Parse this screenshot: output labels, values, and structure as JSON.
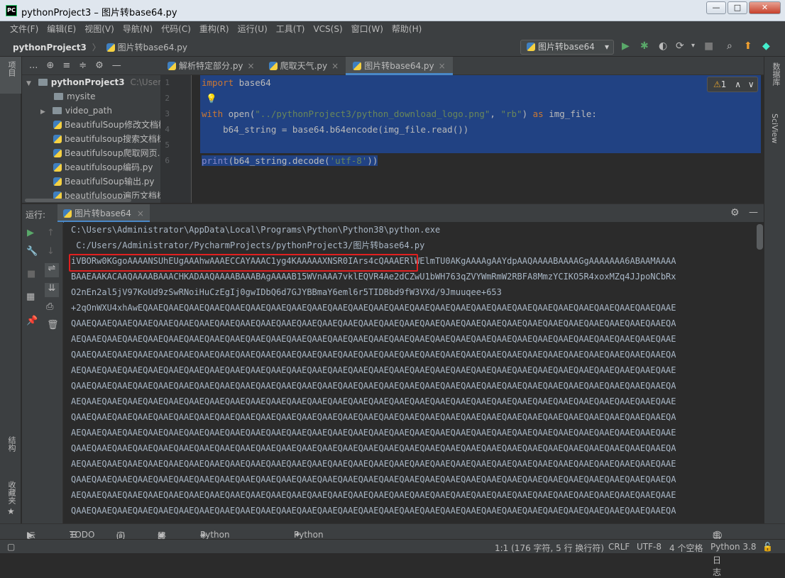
{
  "window": {
    "title": "pythonProject3 – 图片转base64.py",
    "logo_text": "PC",
    "minimize": "—",
    "maximize": "□",
    "close": "✕"
  },
  "menu": [
    "文件(F)",
    "编辑(E)",
    "视图(V)",
    "导航(N)",
    "代码(C)",
    "重构(R)",
    "运行(U)",
    "工具(T)",
    "VCS(S)",
    "窗口(W)",
    "帮助(H)"
  ],
  "breadcrumb": {
    "project": "pythonProject3",
    "file": "图片转base64.py"
  },
  "run_config": "图片转base64",
  "left_strip_label": "项目",
  "left_strip_bottom": [
    "结构",
    "收藏夹"
  ],
  "right_strip_labels": [
    "数据库",
    "SciView"
  ],
  "project_tools": {
    "dropdown": "...",
    "target": "⊕",
    "collapse": "≡",
    "expand": "≑",
    "settings": "⚙",
    "hide": "—"
  },
  "project_tree": {
    "root": {
      "name": "pythonProject3",
      "path": "C:\\Users"
    },
    "items": [
      {
        "type": "folder",
        "name": "mysite",
        "expandable": false
      },
      {
        "type": "folder",
        "name": "video_path",
        "expandable": true
      },
      {
        "type": "file",
        "name": "BeautifulSoup修改文档树"
      },
      {
        "type": "file",
        "name": "beautifulsoup搜索文档树"
      },
      {
        "type": "file",
        "name": "Beautifulsoup爬取网页.py"
      },
      {
        "type": "file",
        "name": "beautifulsoup编码.py"
      },
      {
        "type": "file",
        "name": "BeautifulSoup输出.py"
      },
      {
        "type": "file",
        "name": "beautifulsoup遍历文档树"
      }
    ]
  },
  "editor_tabs": [
    {
      "label": "解析特定部分.py",
      "active": false
    },
    {
      "label": "爬取天气.py",
      "active": false
    },
    {
      "label": "图片转base64.py",
      "active": true
    }
  ],
  "inspection": {
    "warnings": "1",
    "up": "∧",
    "down": "∨"
  },
  "code": {
    "line_numbers": [
      "1",
      "2",
      "3",
      "4",
      "5",
      "6"
    ],
    "l1_kw": "import",
    "l1_rest": " base64",
    "l3_kw": "with",
    "l3_a": " open(",
    "l3_str1": "\"../pythonProject3/python_download_logo.png\"",
    "l3_b": ", ",
    "l3_str2": "\"rb\"",
    "l3_c": ") ",
    "l3_kw2": "as",
    "l3_d": " img_file:",
    "l4": "    b64_string = base64.b64encode(img_file.read())",
    "l6_fn": "print",
    "l6_a": "(b64_string.decode(",
    "l6_str": "'utf-8'",
    "l6_b": "))"
  },
  "run_panel": {
    "label": "运行:",
    "tab": "图片转base64",
    "close": "×",
    "settings": "⚙",
    "hide": "—"
  },
  "console_lines": [
    "C:\\Users\\Administrator\\AppData\\Local\\Programs\\Python\\Python38\\python.exe",
    " C:/Users/Administrator/PycharmProjects/pythonProject3/图片转base64.py",
    "iVBORw0KGgoAAAANSUhEUgAAAhwAAAECCAYAAAC1yg4KAAAAAXNSR0IArs4cQAAAERlWElmTU0AKgAAAAgAAYdpAAQAAAABAAAAGgAAAAAAA6ABAAMAAAA",
    "BAAEAAKACAAQAAAABAAACHKADAAQAAAABAAABAgAAAAB15WVnAAA7vklEQVR4Ae2dCZwU1bWH763qZVYWmRmW2RBFA8MmzYCIKO5R4xoxMZq4JJpoNCbRx",
    "O2nEn2al5jV97KoUd9zSwRNoiHuCzEgIj0gwIDbQ6d7GJYBBmaY6eml6r5TIDBbd9fW3VXd/9Jmuuqee+653",
    "+2qOnWXU4xhAwEQAAEQAAEQAAEQAAEQAAEQAAEQAAEQAAEQAAEQAAEQAAEQAAEQAAEQAAEQAAEQAAEQAAEQAAEQAAEQAAEQAAEQAAEQAAEQAAEQAAEQAAE",
    "QAAEQAAEQAAEQAAEQAAEQAAEQAAEQAAEQAAEQAAEQAAEQAAEQAAEQAAEQAAEQAAEQAAEQAAEQAAEQAAEQAAEQAAEQAAEQAAEQAAEQAAEQAAEQAAEQAAEQA",
    "AEQAAEQAAEQAAEQAAEQAAEQAAEQAAEQAAEQAAEQAAEQAAEQAAEQAAEQAAEQAAEQAAEQAAEQAAEQAAEQAAEQAAEQAAEQAAEQAAEQAAEQAAEQAAEQAAEQAAE",
    "QAAEQAAEQAAEQAAEQAAEQAAEQAAEQAAEQAAEQAAEQAAEQAAEQAAEQAAEQAAEQAAEQAAEQAAEQAAEQAAEQAAEQAAEQAAEQAAEQAAEQAAEQAAEQAAEQAAEQA",
    "AEQAAEQAAEQAAEQAAEQAAEQAAEQAAEQAAEQAAEQAAEQAAEQAAEQAAEQAAEQAAEQAAEQAAEQAAEQAAEQAAEQAAEQAAEQAAEQAAEQAAEQAAEQAAEQAAEQAAE",
    "QAAEQAAEQAAEQAAEQAAEQAAEQAAEQAAEQAAEQAAEQAAEQAAEQAAEQAAEQAAEQAAEQAAEQAAEQAAEQAAEQAAEQAAEQAAEQAAEQAAEQAAEQAAEQAAEQAAEQA",
    "AEQAAEQAAEQAAEQAAEQAAEQAAEQAAEQAAEQAAEQAAEQAAEQAAEQAAEQAAEQAAEQAAEQAAEQAAEQAAEQAAEQAAEQAAEQAAEQAAEQAAEQAAEQAAEQAAEQAAE",
    "QAAEQAAEQAAEQAAEQAAEQAAEQAAEQAAEQAAEQAAEQAAEQAAEQAAEQAAEQAAEQAAEQAAEQAAEQAAEQAAEQAAEQAAEQAAEQAAEQAAEQAAEQAAEQAAEQAAEQA",
    "AEQAAEQAAEQAAEQAAEQAAEQAAEQAAEQAAEQAAEQAAEQAAEQAAEQAAEQAAEQAAEQAAEQAAEQAAEQAAEQAAEQAAEQAAEQAAEQAAEQAAEQAAEQAAEQAAEQAAE",
    "QAAEQAAEQAAEQAAEQAAEQAAEQAAEQAAEQAAEQAAEQAAEQAAEQAAEQAAEQAAEQAAEQAAEQAAEQAAEQAAEQAAEQAAEQAAEQAAEQAAEQAAEQAAEQAAEQAAEQA",
    "AEQAAEQAAEQAAEQAAEQAAEQAAEQAAEQAAEQAAEQAAEQAAEQAAEQAAEQAAEQAAEQAAEQAAEQAAEQAAEQAAEQAAEQAAEQAAEQAAEQAAEQAAEQAAEQAAEQAAE",
    "QAAEQAAEQAAEQAAEQAAEQAAEQAAEQAAEQAAEQAAEQAAEQAAEQAAEQAAEQAAEQAAEQAAEQAAEQAAEQAAEQAAEQAAEQAAEQAAEQAAEQAAEQAAEQAAEQAAEQA",
    "AEQAAEQAAEQAAEQAAEQAAEQAAEQAAEQAAEQAAEQAAEQAAEQAAEQAAEQAAEQAAEQAAEQAAEQAAEQAAEQAAEQAAEQAAEQAAEQAAEQAAEQAAEQAAEQAAEQAAE",
    "QAAEQAAEQAAEQAAEQAAEQAAEQAAEQAAEQAAEQAAEQAAEQAAEQAAEQAAEQAAEQAAEQAAEQAAEQAAEQAAEQAAEQAAEQAAEQAAEQAAEQAAEQAAEQAAEQAAEQA"
  ],
  "bottom_tabs": [
    "运行",
    "TODO",
    "问题",
    "终端",
    "Python Packages",
    "Python 控制台"
  ],
  "event_log": "事件日志",
  "status": {
    "position": "1:1 (176 字符, 5 行 换行符)",
    "line_sep": "CRLF",
    "encoding": "UTF-8",
    "indent": "4 个空格",
    "interpreter": "Python 3.8"
  },
  "colors": {
    "selection": "#214283",
    "keyword": "#cc7832",
    "string": "#6a8759",
    "builtin": "#8888c6",
    "highlight_box": "#e02020"
  }
}
